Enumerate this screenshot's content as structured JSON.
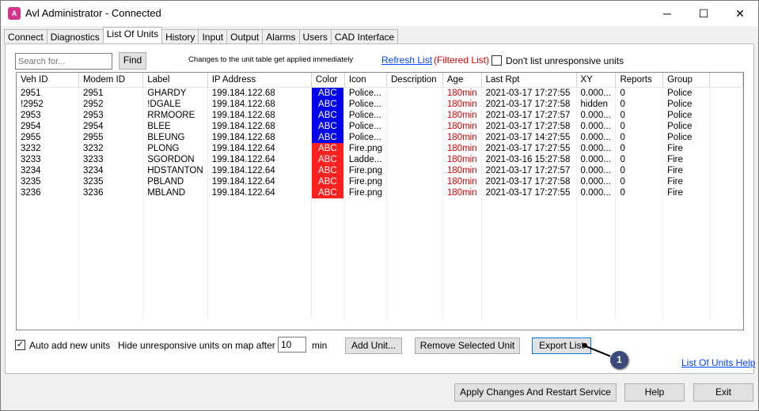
{
  "window": {
    "title": "Avl Administrator - Connected",
    "app_icon": "avl-app-icon",
    "controls": {
      "minimize": "─",
      "maximize": "☐",
      "close": "✕"
    }
  },
  "tabs": [
    {
      "label": "Connect"
    },
    {
      "label": "Diagnostics"
    },
    {
      "label": "List Of Units",
      "active": true
    },
    {
      "label": "History"
    },
    {
      "label": "Input"
    },
    {
      "label": "Output"
    },
    {
      "label": "Alarms"
    },
    {
      "label": "Users"
    },
    {
      "label": "CAD Interface"
    }
  ],
  "toolbar": {
    "search_placeholder": "Search for...",
    "find_label": "Find",
    "note": "Changes to the unit table get applied immediately",
    "refresh_link": "Refresh List",
    "filtered_label": "(Filtered List)",
    "unresponsive_label": "Don't list unresponsive units",
    "unresponsive_checked": false
  },
  "table": {
    "columns": [
      "Veh ID",
      "Modem ID",
      "Label",
      "IP Address",
      "Color",
      "Icon",
      "Description",
      "Age",
      "Last Rpt",
      "XY",
      "Reports",
      "Group"
    ],
    "rows": [
      [
        "2951",
        "2951",
        "GHARDY",
        "199.184.122.68",
        "ABC",
        "Police...",
        "",
        "180min",
        "2021-03-17 17:27:55",
        "0.000...",
        "0",
        "Police"
      ],
      [
        "!2952",
        "2952",
        "!DGALE",
        "199.184.122.68",
        "ABC",
        "Police...",
        "",
        "180min",
        "2021-03-17 17:27:58",
        "hidden",
        "0",
        "Police"
      ],
      [
        "2953",
        "2953",
        "RRMOORE",
        "199.184.122.68",
        "ABC",
        "Police...",
        "",
        "180min",
        "2021-03-17 17:27:57",
        "0.000...",
        "0",
        "Police"
      ],
      [
        "2954",
        "2954",
        "BLEE",
        "199.184.122.68",
        "ABC",
        "Police...",
        "",
        "180min",
        "2021-03-17 17:27:58",
        "0.000...",
        "0",
        "Police"
      ],
      [
        "2955",
        "2955",
        "BLEUNG",
        "199.184.122.68",
        "ABC",
        "Police...",
        "",
        "180min",
        "2021-03-17 14:27:55",
        "0.000...",
        "0",
        "Police"
      ],
      [
        "3232",
        "3232",
        "PLONG",
        "199.184.122.64",
        "ABC",
        "Fire.png",
        "",
        "180min",
        "2021-03-17 17:27:55",
        "0.000...",
        "0",
        "Fire"
      ],
      [
        "3233",
        "3233",
        "SGORDON",
        "199.184.122.64",
        "ABC",
        "Ladde...",
        "",
        "180min",
        "2021-03-16 15:27:58",
        "0.000...",
        "0",
        "Fire"
      ],
      [
        "3234",
        "3234",
        "HDSTANTON",
        "199.184.122.64",
        "ABC",
        "Fire.png",
        "",
        "180min",
        "2021-03-17 17:27:57",
        "0.000...",
        "0",
        "Fire"
      ],
      [
        "3235",
        "3235",
        "PBLAND",
        "199.184.122.64",
        "ABC",
        "Fire.png",
        "",
        "180min",
        "2021-03-17 17:27:58",
        "0.000...",
        "0",
        "Fire"
      ],
      [
        "3236",
        "3236",
        "MBLAND",
        "199.184.122.64",
        "ABC",
        "Fire.png",
        "",
        "180min",
        "2021-03-17 17:27:55",
        "0.000...",
        "0",
        "Fire"
      ]
    ],
    "row_colors": [
      "#0000ee",
      "#0000ee",
      "#0000ee",
      "#0000ee",
      "#0000ee",
      "#ff2020",
      "#ff2020",
      "#ff2020",
      "#ff2020",
      "#ff2020"
    ]
  },
  "bottom": {
    "auto_add_label": "Auto add new units",
    "auto_add_checked": true,
    "hide_label": "Hide unresponsive units on map after",
    "hide_minutes": "10",
    "min_label": "min",
    "add_unit_label": "Add Unit...",
    "remove_label": "Remove Selected Unit",
    "export_label": "Export List",
    "help_link": "List Of Units Help",
    "callout_number": "1"
  },
  "footer": {
    "apply_label": "Apply Changes And Restart Service",
    "help_label": "Help",
    "exit_label": "Exit"
  }
}
